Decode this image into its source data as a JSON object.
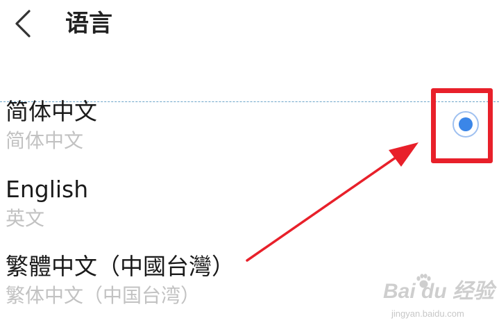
{
  "header": {
    "title": "语言",
    "back_icon": "chevron-left-icon"
  },
  "languages": [
    {
      "name": "简体中文",
      "subtitle": "简体中文",
      "selected": true
    },
    {
      "name": "English",
      "subtitle": "英文",
      "selected": false
    },
    {
      "name": "繁體中文（中國台灣）",
      "subtitle": "繁体中文（中国台湾）",
      "selected": false
    }
  ],
  "annotation": {
    "box_color": "#e8202a",
    "arrow_color": "#e8202a"
  },
  "radio": {
    "accent_color": "#3b86e8"
  },
  "watermark": {
    "brand": "Bai du 经验",
    "url": "jingyan.baidu.com"
  }
}
